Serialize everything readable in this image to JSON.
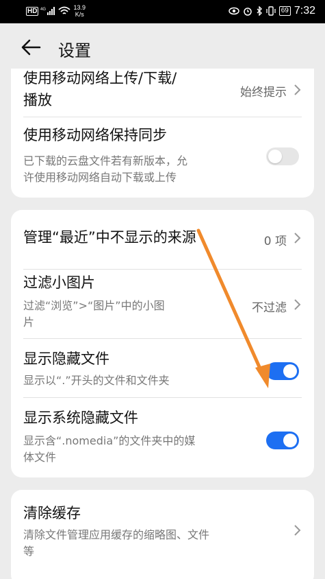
{
  "status_bar": {
    "network_badge": "HD",
    "signal": "4G",
    "speed_value": "13.9",
    "speed_unit": "K/s",
    "battery": "69",
    "time": "7:32",
    "icons": [
      "eye-icon",
      "alarm-icon",
      "bluetooth-icon",
      "vibrate-icon",
      "battery-icon"
    ]
  },
  "header": {
    "title": "设置",
    "back_icon": "arrow-left-icon"
  },
  "section1": {
    "upload_row": {
      "title_line1": "使用移动网络上传/下载/",
      "title_line2": "播放",
      "value": "始终提示"
    },
    "sync_row": {
      "title": "使用移动网络保持同步",
      "subtitle_line1": "已下载的云盘文件若有新版本，允",
      "subtitle_line2": "许使用移动网络自动下载或上传",
      "toggle_on": false
    }
  },
  "section2": {
    "recent_row": {
      "title": "管理“最近”中不显示的来源",
      "value": "0 项"
    },
    "filter_row": {
      "title": "过滤小图片",
      "subtitle_line1": "过滤“浏览”>“图片”中的小图",
      "subtitle_line2": "片",
      "value": "不过滤"
    },
    "hidden_row": {
      "title": "显示隐藏文件",
      "subtitle": "显示以“.”开头的文件和文件夹",
      "toggle_on": true
    },
    "system_hidden_row": {
      "title": "显示系统隐藏文件",
      "subtitle_line1": "显示含“.nomedia”的文件夹中的媒",
      "subtitle_line2": "体文件",
      "toggle_on": true
    }
  },
  "section3": {
    "cache_row": {
      "title": "清除缓存",
      "subtitle_line1": "清除文件管理应用缓存的缩略图、文件",
      "subtitle_line2": "等"
    }
  },
  "colors": {
    "background": "#ececec",
    "card": "#ffffff",
    "toggle_on": "#1d6ff2",
    "toggle_off": "#e6e6e6",
    "annotation_arrow": "#f08a2c"
  }
}
